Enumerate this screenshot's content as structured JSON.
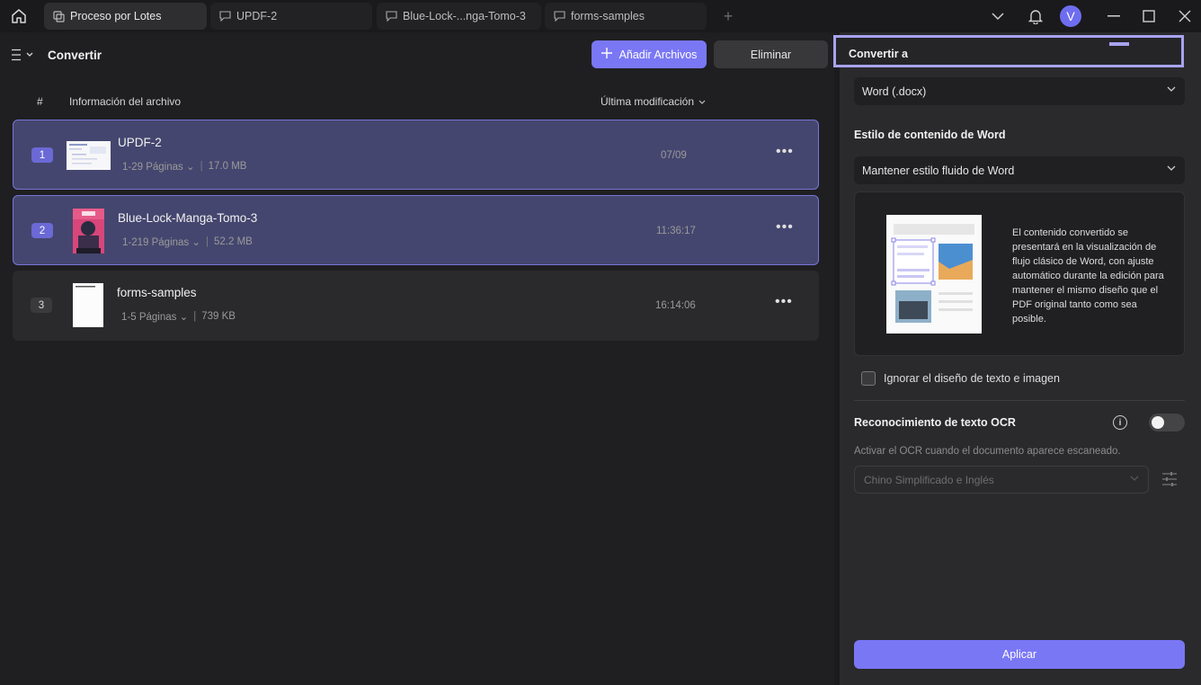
{
  "tabs": [
    {
      "label": "Proceso por Lotes",
      "icon": "batch-icon"
    },
    {
      "label": "UPDF-2",
      "icon": "comment-icon"
    },
    {
      "label": "Blue-Lock-...nga-Tomo-3",
      "icon": "comment-icon"
    },
    {
      "label": "forms-samples",
      "icon": "comment-icon"
    }
  ],
  "user": {
    "avatar_letter": "V"
  },
  "left": {
    "title": "Convertir",
    "add_button": "Añadir Archivos",
    "delete_button": "Eliminar",
    "columns": {
      "num": "#",
      "info": "Información del archivo",
      "modified": "Última modificación"
    },
    "files": [
      {
        "index": "1",
        "name": "UPDF-2",
        "pages": "1-29 Páginas",
        "size": "17.0 MB",
        "modified": "07/09",
        "selected": true
      },
      {
        "index": "2",
        "name": "Blue-Lock-Manga-Tomo-3",
        "pages": "1-219 Páginas",
        "size": "52.2 MB",
        "modified": "11:36:17",
        "selected": true
      },
      {
        "index": "3",
        "name": "forms-samples",
        "pages": "1-5 Páginas",
        "size": "739 KB",
        "modified": "16:14:06",
        "selected": false
      }
    ]
  },
  "right": {
    "header": "Convertir a",
    "format_value": "Word (.docx)",
    "style_section": "Estilo de contenido de Word",
    "style_value": "Mantener estilo fluido de Word",
    "preview_text": "El contenido convertido se presentará en la visualización de flujo clásico de Word, con ajuste automático durante la edición para mantener el mismo diseño que el PDF original tanto como sea posible.",
    "ignore_layout_label": "Ignorar el diseño de texto e imagen",
    "ignore_layout_checked": false,
    "ocr_title": "Reconocimiento de texto OCR",
    "ocr_enabled": false,
    "ocr_description": "Activar el OCR cuando el documento aparece escaneado.",
    "ocr_language": "Chino Simplificado e Inglés",
    "apply_button": "Aplicar"
  },
  "colors": {
    "accent": "#7a77f5",
    "selected_row": "#45466f",
    "highlight_border": "#a9a3ef"
  }
}
